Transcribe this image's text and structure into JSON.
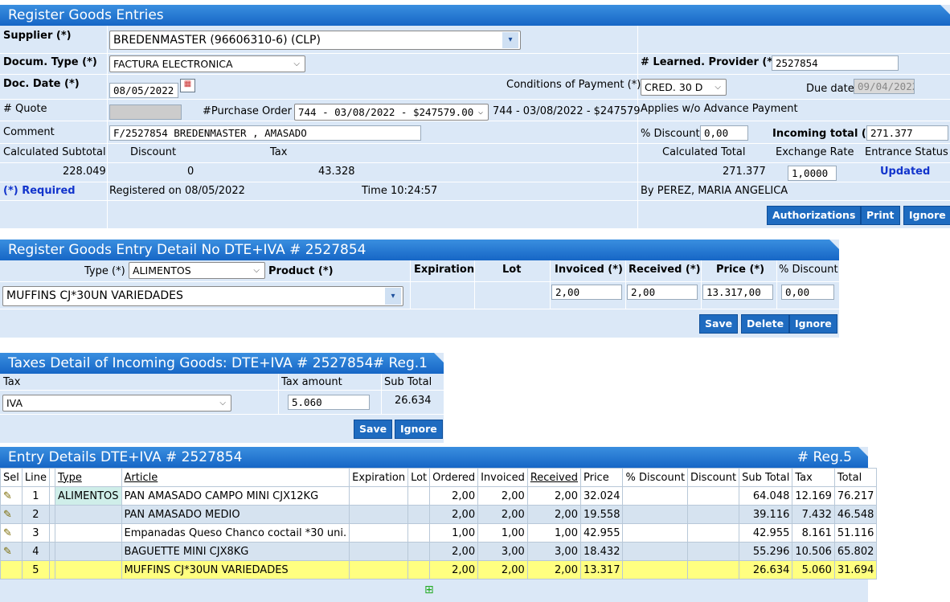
{
  "header": {
    "title": "Register Goods Entries",
    "supplier_label": "Supplier (*)",
    "supplier_value": "BREDENMASTER (96606310-6) (CLP)",
    "doc_type_label": "Docum. Type (*)",
    "doc_type_value": "FACTURA ELECTRONICA",
    "learned_provider_label": "# Learned. Provider (*)",
    "learned_provider_value": "2527854",
    "doc_date_label": "Doc. Date (*)",
    "doc_date_value": "08/05/2022",
    "conditions_label": "Conditions of Payment (*)",
    "conditions_value": "CRED. 30 D",
    "due_date_label": "Due date",
    "due_date_value": "09/04/2022",
    "quote_label": "# Quote",
    "purchase_order_label": "#Purchase Order",
    "purchase_order_value": "744 - 03/08/2022 - $247579.00",
    "purchase_order_text": "744 - 03/08/2022 - $247579",
    "advance_payment": "Applies w/o Advance Payment",
    "comment_label": "Comment",
    "comment_value": "F/2527854 BREDENMASTER , AMASADO",
    "discount_pct_label": "% Discount",
    "discount_pct_value": "0,00",
    "incoming_total_label": "Incoming total (*)",
    "incoming_total_value": "271.377",
    "calc_subtotal_label": "Calculated Subtotal",
    "discount_label": "Discount",
    "tax_label": "Tax",
    "calc_total_label": "Calculated Total",
    "exchange_rate_label": "Exchange Rate",
    "entrance_status_label": "Entrance Status",
    "calc_subtotal_value": "228.049",
    "discount_value": "0",
    "tax_value": "43.328",
    "calc_total_value": "271.377",
    "exchange_rate_value": "1,0000",
    "entrance_status_value": "Updated",
    "required_note": "(*) Required",
    "registered_on": "Registered on 08/05/2022",
    "time": "Time 10:24:57",
    "by": "By PEREZ, MARIA ANGELICA",
    "authorizations_btn": "Authorizations",
    "print_btn": "Print",
    "ignore_btn": "Ignore"
  },
  "detail": {
    "title": "Register Goods Entry Detail No DTE+IVA # 2527854",
    "type_label": "Type (*)",
    "type_value": "ALIMENTOS",
    "product_label": "Product (*)",
    "product_value": "MUFFINS CJ*30UN VARIEDADES",
    "expiration_label": "Expiration",
    "lot_label": "Lot",
    "invoiced_label": "Invoiced (*)",
    "received_label": "Received (*)",
    "price_label": "Price (*)",
    "discount_label": "% Discount",
    "invoiced_value": "2,00",
    "received_value": "2,00",
    "price_value": "13.317,00",
    "discount_value": "0,00",
    "save_btn": "Save",
    "delete_btn": "Delete",
    "ignore_btn": "Ignore"
  },
  "taxes": {
    "title": "Taxes Detail of Incoming Goods: DTE+IVA # 2527854",
    "reg": "# Reg.1",
    "tax_label": "Tax",
    "tax_amount_label": "Tax amount",
    "subtotal_label": "Sub Total",
    "tax_value": "IVA",
    "tax_amount_value": "5.060",
    "subtotal_value": "26.634",
    "save_btn": "Save",
    "ignore_btn": "Ignore"
  },
  "entries": {
    "title": "Entry Details DTE+IVA # 2527854",
    "reg": "# Reg.5",
    "columns": [
      "Sel",
      "Line",
      "",
      "Type",
      "Article",
      "Expiration",
      "Lot",
      "Ordered",
      "Invoiced",
      "Received",
      "Price",
      "% Discount",
      "Discount",
      "Sub Total",
      "Tax",
      "Total"
    ],
    "rows": [
      {
        "line": "1",
        "type": "ALIMENTOS",
        "article": "PAN AMASADO CAMPO MINI CJX12KG",
        "ordered": "2,00",
        "invoiced": "2,00",
        "received": "2,00",
        "price": "32.024",
        "subtotal": "64.048",
        "tax": "12.169",
        "total": "76.217"
      },
      {
        "line": "2",
        "type": "",
        "article": "PAN AMASADO MEDIO",
        "ordered": "2,00",
        "invoiced": "2,00",
        "received": "2,00",
        "price": "19.558",
        "subtotal": "39.116",
        "tax": "7.432",
        "total": "46.548"
      },
      {
        "line": "3",
        "type": "",
        "article": "Empanadas Queso Chanco coctail *30 uni.",
        "ordered": "1,00",
        "invoiced": "1,00",
        "received": "1,00",
        "price": "42.955",
        "subtotal": "42.955",
        "tax": "8.161",
        "total": "51.116"
      },
      {
        "line": "4",
        "type": "",
        "article": "BAGUETTE MINI CJX8KG",
        "ordered": "2,00",
        "invoiced": "3,00",
        "received": "3,00",
        "price": "18.432",
        "subtotal": "55.296",
        "tax": "10.506",
        "total": "65.802"
      },
      {
        "line": "5",
        "type": "",
        "article": "MUFFINS CJ*30UN VARIEDADES",
        "ordered": "2,00",
        "invoiced": "2,00",
        "received": "2,00",
        "price": "13.317",
        "subtotal": "26.634",
        "tax": "5.060",
        "total": "31.694"
      }
    ]
  },
  "colors": {
    "accent": "#1666c6",
    "panel": "#dbe8f7",
    "highlight": "#ffff80"
  },
  "icons": {
    "edit": "pencil-icon",
    "calendar": "calendar-icon",
    "add": "add-row-icon"
  }
}
